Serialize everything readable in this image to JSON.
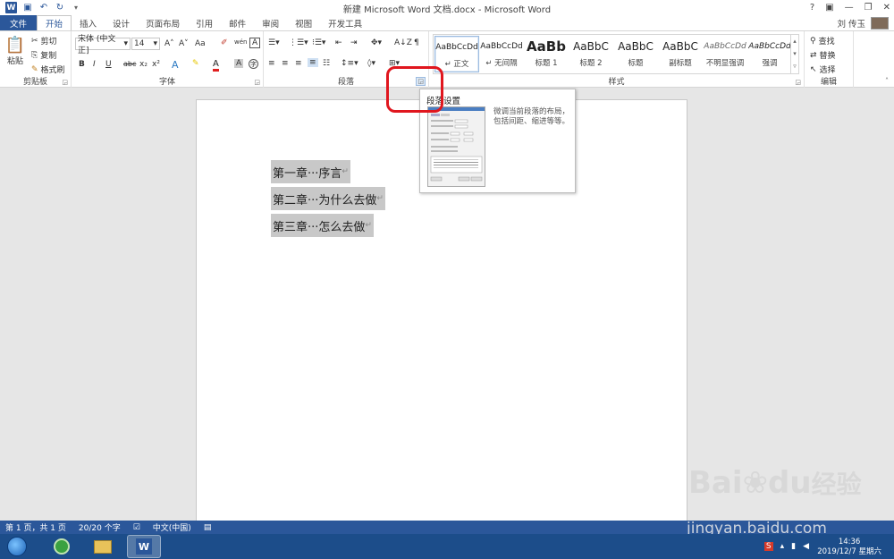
{
  "window": {
    "title": "新建 Microsoft Word 文档.docx - Microsoft Word",
    "user": "刘 传玉",
    "controls": [
      "?",
      "▣",
      "—",
      "❐",
      "✕"
    ]
  },
  "tabs": [
    "文件",
    "开始",
    "插入",
    "设计",
    "页面布局",
    "引用",
    "邮件",
    "审阅",
    "视图",
    "开发工具"
  ],
  "ribbon": {
    "clipboard": {
      "label": "剪贴板",
      "paste": "粘贴",
      "cut": "剪切",
      "copy": "复制",
      "format_painter": "格式刷"
    },
    "font": {
      "label": "字体",
      "font_name": "宋体 (中文正]",
      "font_size": "14",
      "aa": "Aa",
      "bold": "B",
      "italic": "I",
      "underline": "U",
      "strike": "abc",
      "sub": "x₂",
      "sup": "x²",
      "grow": "A˄",
      "shrink": "A˅",
      "font_color": "A"
    },
    "paragraph": {
      "label": "段落"
    },
    "styles": {
      "label": "样式",
      "items": [
        {
          "sample": "AaBbCcDd",
          "name": "↵ 正文"
        },
        {
          "sample": "AaBbCcDd",
          "name": "↵ 无间隔"
        },
        {
          "sample": "AaBb",
          "name": "标题 1"
        },
        {
          "sample": "AaBbC",
          "name": "标题 2"
        },
        {
          "sample": "AaBbC",
          "name": "标题"
        },
        {
          "sample": "AaBbC",
          "name": "副标题"
        },
        {
          "sample": "AaBbCcDd",
          "name": "不明显强调"
        },
        {
          "sample": "AaBbCcDd",
          "name": "强调"
        }
      ]
    },
    "editing": {
      "label": "编辑",
      "find": "查找",
      "replace": "替换",
      "select": "选择"
    }
  },
  "tooltip": {
    "title": "段落设置",
    "description": "微调当前段落的布局，包括间距、缩进等等。"
  },
  "document": {
    "lines": [
      "第一章···序言",
      "第二章···为什么去做",
      "第三章···怎么去做"
    ],
    "paragraph_mark": "↵"
  },
  "statusbar": {
    "page": "第 1 页，共 1 页",
    "words": "20/20 个字",
    "language": "中文(中国)"
  },
  "taskbar": {
    "time": "14:36",
    "date": "2019/12/7 星期六"
  },
  "watermark": {
    "brand": "Bai",
    "brand2": "du",
    "suffix": "经验",
    "url": "jingyan.baidu.com"
  }
}
